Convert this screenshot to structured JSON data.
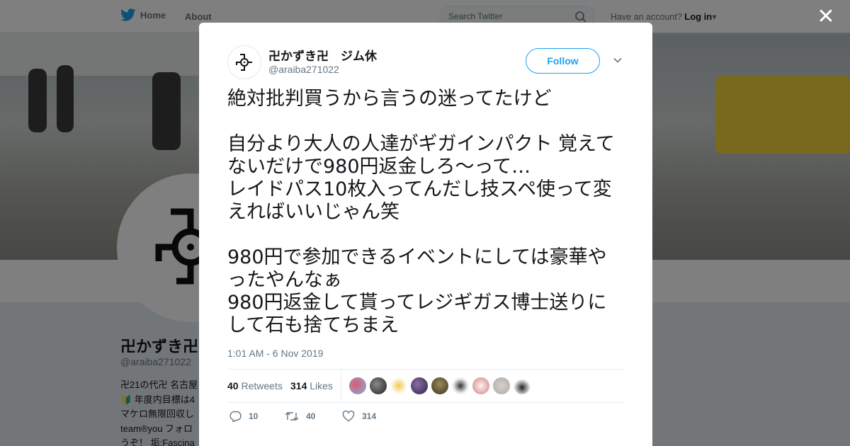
{
  "nav": {
    "home_label": "Home",
    "about_label": "About"
  },
  "search": {
    "placeholder": "Search Twitter"
  },
  "account": {
    "prompt": "Have an account?",
    "login_label": "Log in"
  },
  "profile": {
    "name": "卍かずき卍",
    "handle": "@araiba271022",
    "bio_lines": [
      "卍21の代卍 名古屋",
      "🔰 年度内目標は4",
      "マケロ無限回収し",
      "team®you フォロ",
      "うぞ！ 垢:Fascina"
    ]
  },
  "tweet": {
    "author_name": "卍かずき卍　ジム休",
    "author_handle": "@araiba271022",
    "follow_label": "Follow",
    "text": "絶対批判買うから言うの迷ってたけど\n\n自分より大人の人達がギガインパクト 覚えてないだけで980円返金しろ〜って…\nレイドパス10枚入ってんだし技スペ使って変えればいいじゃん笑\n\n980円で参加できるイベントにしては豪華やったやんなぁ\n980円返金して貰ってレジギガス博士送りにして石も捨てちまえ",
    "timestamp": "1:01 AM - 6 Nov 2019",
    "retweets_count": "40",
    "retweets_label": "Retweets",
    "likes_count": "314",
    "likes_label": "Likes",
    "reply_count": "10",
    "retweet_action_count": "40",
    "like_action_count": "314"
  },
  "colors": {
    "accent": "#1da1f2",
    "muted": "#657786"
  },
  "icons": [
    "twitter-bird-icon",
    "search-icon",
    "caret-down-icon",
    "close-icon",
    "reply-icon",
    "retweet-icon",
    "heart-icon"
  ]
}
